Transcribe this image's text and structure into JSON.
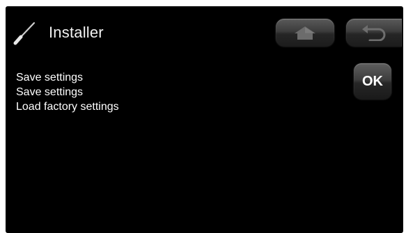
{
  "header": {
    "title": "Installer",
    "icon": "screwdriver-icon"
  },
  "nav": {
    "home_icon": "home-icon",
    "back_icon": "back-arrow-icon"
  },
  "menu": {
    "items": [
      {
        "label": "Save settings"
      },
      {
        "label": "Save settings"
      },
      {
        "label": "Load factory settings"
      }
    ]
  },
  "actions": {
    "ok_label": "OK"
  },
  "colors": {
    "background": "#000000",
    "text": "#ffffff",
    "button": "#3c3c3c"
  }
}
